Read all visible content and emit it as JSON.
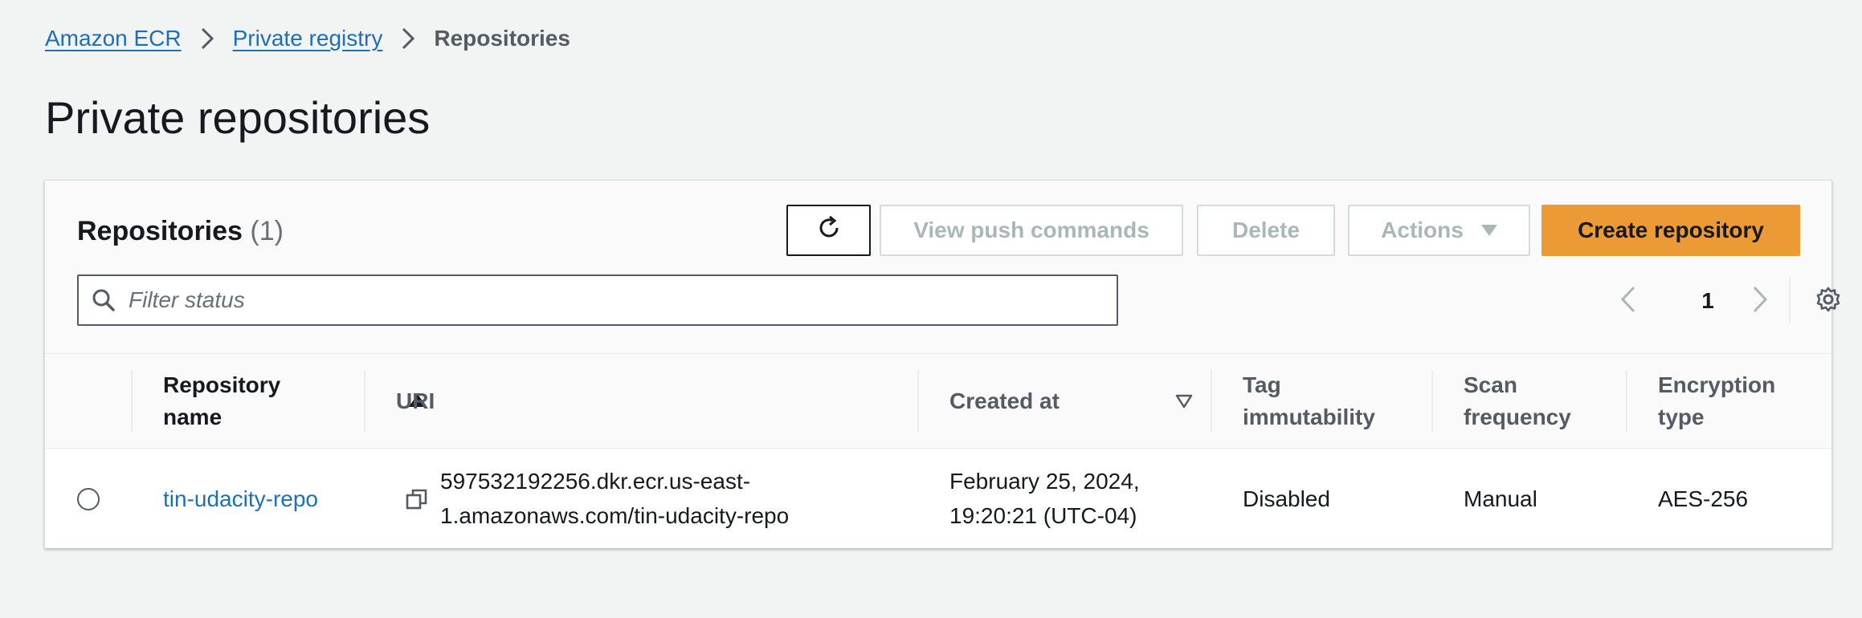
{
  "breadcrumb": {
    "items": [
      "Amazon ECR",
      "Private registry"
    ],
    "current": "Repositories"
  },
  "page_title": "Private repositories",
  "panel": {
    "title": "Repositories",
    "count": "(1)",
    "buttons": {
      "view_push": "View push commands",
      "delete": "Delete",
      "actions": "Actions",
      "create": "Create repository"
    },
    "filter": {
      "placeholder": "Filter status",
      "value": ""
    },
    "pagination": {
      "current_page": "1"
    }
  },
  "table": {
    "columns": [
      "Repository name",
      "URI",
      "Created at",
      "Tag immutability",
      "Scan frequency",
      "Encryption type"
    ],
    "rows": [
      {
        "name": "tin-udacity-repo",
        "uri": "597532192256.dkr.ecr.us-east-1.amazonaws.com/tin-udacity-repo",
        "uri_line1": "597532192256.dkr.ecr.us-east-",
        "uri_line2": "1.amazonaws.com/tin-udacity-repo",
        "created_line1": "February 25, 2024,",
        "created_line2": "19:20:21 (UTC-04)",
        "tag_immutability": "Disabled",
        "scan_frequency": "Manual",
        "encryption_type": "AES-256"
      }
    ]
  },
  "colors": {
    "link": "#1d6fb8",
    "primary_button": "#ec9a36",
    "background": "#f2f3f3"
  },
  "icons": [
    "chevron-right-icon",
    "refresh-icon",
    "caret-down-icon",
    "search-icon",
    "chevron-left-icon",
    "settings-gear-icon",
    "sort-ascending-icon",
    "sort-descending-icon",
    "copy-icon"
  ]
}
